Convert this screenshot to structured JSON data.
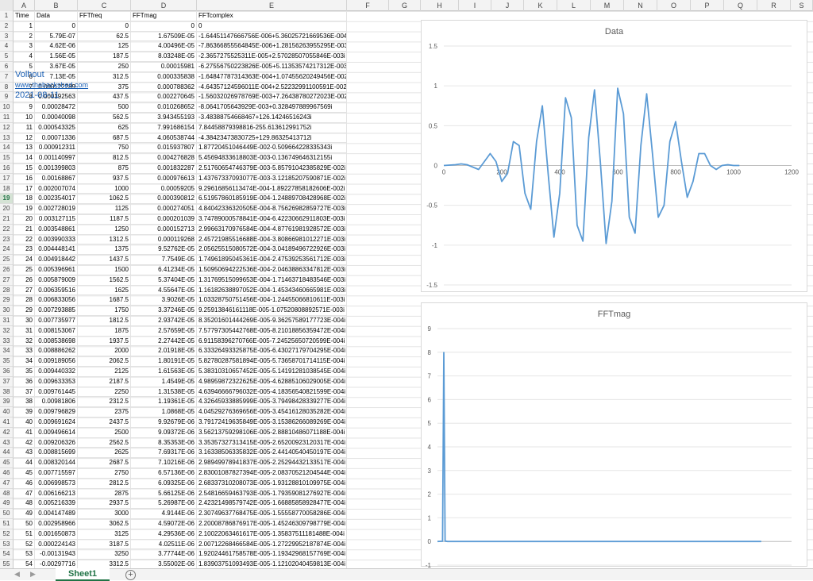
{
  "column_letters": [
    "A",
    "B",
    "C",
    "D",
    "E",
    "F",
    "G",
    "H",
    "I",
    "J",
    "K",
    "L",
    "M",
    "N",
    "O",
    "P",
    "Q",
    "R",
    "S"
  ],
  "selected_row": "19",
  "header_row": {
    "a": "Time",
    "b": "Data",
    "c": "FFTfreq",
    "d": "FFTmag",
    "e": "FFTcomplex"
  },
  "rows": [
    {
      "n": "2",
      "a": "1",
      "b": "0",
      "c": "0",
      "d": "0",
      "e": "0"
    },
    {
      "n": "3",
      "a": "2",
      "b": "5.79E-07",
      "c": "62.5",
      "d": "1.67509E-05",
      "e": "-1.64451147666756E-006+5.36025721669536E-004i"
    },
    {
      "n": "4",
      "a": "3",
      "b": "4.62E-06",
      "c": "125",
      "d": "4.00496E-05",
      "e": "-7.86366855564845E-006+1.28156263955295E-003i"
    },
    {
      "n": "5",
      "a": "4",
      "b": "1.56E-05",
      "c": "187.5",
      "d": "8.03248E-05",
      "e": "-2.3657275525311E-005+2.57028507055846E-003i"
    },
    {
      "n": "6",
      "a": "5",
      "b": "3.67E-05",
      "c": "250",
      "d": "0.00015981",
      "e": "-6.27556750223826E-005+5.11353574217312E-003i"
    },
    {
      "n": "7",
      "a": "6",
      "b": "7.13E-05",
      "c": "312.5",
      "d": "0.000335838",
      "e": "-1.64847787314363E-004+1.07455620249456E-002i"
    },
    {
      "n": "8",
      "a": "7",
      "b": "0.000122289",
      "c": "375",
      "d": "0.000788362",
      "e": "-4.64357124596011E-004+2.52232991100591E-002i"
    },
    {
      "n": "9",
      "a": "8",
      "b": "0.000192563",
      "c": "437.5",
      "d": "0.002270645",
      "e": "-1.56032026978769E-003+7.26438780272023E-002i"
    },
    {
      "n": "10",
      "a": "9",
      "b": "0.00028472",
      "c": "500",
      "d": "0.010268652",
      "e": "-8.0641705643929E-003+0.328497889967569i"
    },
    {
      "n": "11",
      "a": "10",
      "b": "0.00040098",
      "c": "562.5",
      "d": "3.943455193",
      "e": "-3.48388754668467+126.14246516243i"
    },
    {
      "n": "12",
      "a": "11",
      "b": "0.000543325",
      "c": "625",
      "d": "7.991686154",
      "e": "7.84458879398816-255.613612991752i"
    },
    {
      "n": "13",
      "a": "12",
      "b": "0.00071336",
      "c": "687.5",
      "d": "4.060538744",
      "e": "-4.38423473830725+129.86325413712i"
    },
    {
      "n": "14",
      "a": "13",
      "b": "0.000912311",
      "c": "750",
      "d": "0.015937807",
      "e": "1.87720451046449E-002-0.509664228335343i"
    },
    {
      "n": "15",
      "a": "14",
      "b": "0.001140997",
      "c": "812.5",
      "d": "0.004276828",
      "e": "5.45694833618803E-003-0.136749646312155i"
    },
    {
      "n": "16",
      "a": "15",
      "b": "0.001399803",
      "c": "875",
      "d": "0.001832287",
      "e": "2.51760654746379E-003-5.85791042385829E-002i"
    },
    {
      "n": "17",
      "a": "16",
      "b": "0.00168867",
      "c": "937.5",
      "d": "0.000976613",
      "e": "1.43767337093077E-003-3.12185207590871E-002i"
    },
    {
      "n": "18",
      "a": "17",
      "b": "0.002007074",
      "c": "1000",
      "d": "0.00059205",
      "e": "9.29616856113474E-004-1.89227858182606E-002i"
    },
    {
      "n": "19",
      "a": "18",
      "b": "0.002354017",
      "c": "1062.5",
      "d": "0.000390812",
      "e": "6.51957860185919E-004-1.24889708428968E-002i"
    },
    {
      "n": "20",
      "a": "19",
      "b": "0.002728019",
      "c": "1125",
      "d": "0.000274051",
      "e": "4.84042336320505E-004-8.75626982859727E-003i"
    },
    {
      "n": "21",
      "a": "20",
      "b": "0.003127115",
      "c": "1187.5",
      "d": "0.000201039",
      "e": "3.74789000578841E-004-6.42230662911803E-003i"
    },
    {
      "n": "22",
      "a": "21",
      "b": "0.003548861",
      "c": "1250",
      "d": "0.000152713",
      "e": "2.99663170976584E-004-4.87761981928572E-003i"
    },
    {
      "n": "23",
      "a": "22",
      "b": "0.003990333",
      "c": "1312.5",
      "d": "0.000119268",
      "e": "2.45721985516688E-004-3.80866981012271E-003i"
    },
    {
      "n": "24",
      "a": "23",
      "b": "0.004448141",
      "c": "1375",
      "d": "9.52762E-05",
      "e": "2.05625515080572E-004-3.04189496722926E-003i"
    },
    {
      "n": "25",
      "a": "24",
      "b": "0.004918442",
      "c": "1437.5",
      "d": "7.7549E-05",
      "e": "1.74961895045361E-004-2.47539253561712E-003i"
    },
    {
      "n": "26",
      "a": "25",
      "b": "0.005396961",
      "c": "1500",
      "d": "6.41234E-05",
      "e": "1.50950694222536E-004-2.04638863347812E-003i"
    },
    {
      "n": "27",
      "a": "26",
      "b": "0.005879009",
      "c": "1562.5",
      "d": "5.37404E-05",
      "e": "1.31769515099653E-004-1.71463718483546E-003i"
    },
    {
      "n": "28",
      "a": "27",
      "b": "0.006359516",
      "c": "1625",
      "d": "4.55647E-05",
      "e": "1.16182638897052E-004-1.45343460665981E-003i"
    },
    {
      "n": "29",
      "a": "28",
      "b": "0.006833056",
      "c": "1687.5",
      "d": "3.9026E-05",
      "e": "1.03328750751456E-004-1.24455066810611E-003i"
    },
    {
      "n": "30",
      "a": "29",
      "b": "0.007293885",
      "c": "1750",
      "d": "3.37246E-05",
      "e": "9.25913846161118E-005-1.07520808892571E-003i"
    },
    {
      "n": "31",
      "a": "30",
      "b": "0.007735977",
      "c": "1812.5",
      "d": "2.93742E-05",
      "e": "8.35201601444269E-005-9.36257589177723E-004i"
    },
    {
      "n": "32",
      "a": "31",
      "b": "0.008153067",
      "c": "1875",
      "d": "2.57659E-05",
      "e": "7.57797305442768E-005-8.21018856359472E-004i"
    },
    {
      "n": "33",
      "a": "32",
      "b": "0.008538698",
      "c": "1937.5",
      "d": "2.27442E-05",
      "e": "6.91158396270766E-005-7.24525650720599E-004i"
    },
    {
      "n": "34",
      "a": "33",
      "b": "0.008886262",
      "c": "2000",
      "d": "2.01918E-05",
      "e": "6.33326493325875E-005-6.43027179704295E-004i"
    },
    {
      "n": "35",
      "a": "34",
      "b": "0.009189056",
      "c": "2062.5",
      "d": "1.80191E-05",
      "e": "5.82780287581894E-005-5.73658701714115E-004i"
    },
    {
      "n": "36",
      "a": "35",
      "b": "0.009440332",
      "c": "2125",
      "d": "1.61563E-05",
      "e": "5.38310310657452E-005-5.14191281038545E-004i"
    },
    {
      "n": "37",
      "a": "36",
      "b": "0.009633353",
      "c": "2187.5",
      "d": "1.4549E-05",
      "e": "4.98959872322625E-005-4.62885106029005E-004i"
    },
    {
      "n": "38",
      "a": "37",
      "b": "0.009761445",
      "c": "2250",
      "d": "1.31538E-05",
      "e": "4.63946666796032E-005-4.18356540821599E-004i"
    },
    {
      "n": "39",
      "a": "38",
      "b": "0.00981806",
      "c": "2312.5",
      "d": "1.19361E-05",
      "e": "4.32645933885999E-005-3.79498428339277E-004i"
    },
    {
      "n": "40",
      "a": "39",
      "b": "0.009796829",
      "c": "2375",
      "d": "1.0868E-05",
      "e": "4.04529276369656E-005-3.45416128035282E-004i"
    },
    {
      "n": "41",
      "a": "40",
      "b": "0.009691624",
      "c": "2437.5",
      "d": "9.92679E-06",
      "e": "3.79172419635849E-005-3.15386266089269E-004i"
    },
    {
      "n": "42",
      "a": "41",
      "b": "0.009496614",
      "c": "2500",
      "d": "9.09372E-06",
      "e": "3.56213759298106E-005-2.88810486071188E-004i"
    },
    {
      "n": "43",
      "a": "42",
      "b": "0.009206326",
      "c": "2562.5",
      "d": "8.35353E-06",
      "e": "3.35357327313415E-005-2.65200923120317E-004i"
    },
    {
      "n": "44",
      "a": "43",
      "b": "0.008815699",
      "c": "2625",
      "d": "7.69317E-06",
      "e": "3.16338506335832E-005-2.44140540450197E-004i"
    },
    {
      "n": "45",
      "a": "44",
      "b": "0.008320144",
      "c": "2687.5",
      "d": "7.10216E-06",
      "e": "2.98949978941837E-005-2.25294432133517E-004i"
    },
    {
      "n": "46",
      "a": "45",
      "b": "0.007715597",
      "c": "2750",
      "d": "6.57136E-06",
      "e": "2.83001087827394E-005-2.08370521204544E-004i"
    },
    {
      "n": "47",
      "a": "46",
      "b": "0.006998573",
      "c": "2812.5",
      "d": "6.09325E-06",
      "e": "2.68337310208073E-005-1.93128810109975E-004i"
    },
    {
      "n": "48",
      "a": "47",
      "b": "0.006166213",
      "c": "2875",
      "d": "5.66125E-06",
      "e": "2.54816659463793E-005-1.79359081276927E-004i"
    },
    {
      "n": "49",
      "a": "48",
      "b": "0.005216339",
      "c": "2937.5",
      "d": "5.26987E-06",
      "e": "2.42321498579742E-005-1.66885858928477E-004i"
    },
    {
      "n": "50",
      "a": "49",
      "b": "0.004147489",
      "c": "3000",
      "d": "4.9144E-06",
      "e": "2.30749637768475E-005-1.55558770058286E-004i"
    },
    {
      "n": "51",
      "a": "50",
      "b": "0.002958966",
      "c": "3062.5",
      "d": "4.59072E-06",
      "e": "2.20008786876917E-005-1.45246309798779E-004i"
    },
    {
      "n": "52",
      "a": "51",
      "b": "0.001650873",
      "c": "3125",
      "d": "4.29536E-06",
      "e": "2.10022063461617E-005-1.35837511181488E-004i"
    },
    {
      "n": "53",
      "a": "52",
      "b": "0.000224143",
      "c": "3187.5",
      "d": "4.02511E-06",
      "e": "2.00712268466584E-005-1.27229952187874E-004i"
    },
    {
      "n": "54",
      "a": "53",
      "b": "-0.00131943",
      "c": "3250",
      "d": "3.77744E-06",
      "e": "1.92024461758578E-005-1.19342968157769E-004i"
    },
    {
      "n": "55",
      "a": "54",
      "b": "-0.00297716",
      "c": "3312.5",
      "d": "3.55002E-06",
      "e": "1.83903751093493E-005-1.12102040459813E-004i"
    }
  ],
  "watermark": {
    "author": "Volhout",
    "site": "www.thebackshed.com",
    "date": "2021-08-11"
  },
  "sheet_tab": "Sheet1",
  "add_sheet_symbol": "+",
  "accent_color": "#217346",
  "series_color": "#5b9bd5",
  "chart_data": [
    {
      "type": "line",
      "title": "Data",
      "xlim": [
        0,
        1200
      ],
      "ylim": [
        -1.5,
        1.5
      ],
      "xticks": [
        "0",
        "200",
        "400",
        "600",
        "800",
        "1000",
        "1200"
      ],
      "yticks": [
        "1.5",
        "1",
        "0.5",
        "0",
        "-0.5",
        "-1",
        "-1.5"
      ],
      "grid": true,
      "description_formula": "chirp-like burst, zero outside ~0-1024, peak about 1 near x=580",
      "x": [
        0,
        20,
        40,
        60,
        80,
        100,
        120,
        140,
        160,
        180,
        200,
        220,
        240,
        260,
        280,
        300,
        320,
        340,
        360,
        380,
        400,
        420,
        440,
        460,
        480,
        500,
        520,
        540,
        560,
        580,
        600,
        620,
        640,
        660,
        680,
        700,
        720,
        740,
        760,
        780,
        800,
        820,
        840,
        860,
        880,
        900,
        920,
        940,
        960,
        980,
        1000,
        1020
      ],
      "values": [
        0,
        0.005,
        0.01,
        0.02,
        0.01,
        -0.02,
        -0.05,
        0.05,
        0.15,
        0.05,
        -0.2,
        -0.1,
        0.3,
        0.25,
        -0.35,
        -0.55,
        0.3,
        0.75,
        -0.1,
        -0.9,
        -0.35,
        0.85,
        0.6,
        -0.75,
        -0.95,
        0.35,
        0.95,
        0.05,
        -0.98,
        -0.45,
        0.97,
        0.65,
        -0.65,
        -0.85,
        0.25,
        0.9,
        0.15,
        -0.65,
        -0.5,
        0.3,
        0.55,
        0.05,
        -0.4,
        -0.2,
        0.15,
        0.15,
        0.0,
        -0.05,
        0.0,
        0.01,
        0.0,
        0.0
      ]
    },
    {
      "type": "line",
      "title": "FFTmag",
      "xlim": [
        0,
        35000
      ],
      "ylim": [
        -1,
        9
      ],
      "xticks": [
        "0",
        "5000",
        "10000",
        "15000",
        "20000",
        "25000",
        "30000",
        "35000"
      ],
      "yticks": [
        "9",
        "8",
        "7",
        "6",
        "5",
        "4",
        "3",
        "2",
        "1",
        "0",
        "-1"
      ],
      "grid": true,
      "x": [
        0,
        500,
        562.5,
        625,
        687.5,
        750,
        1000,
        2000,
        5000,
        10000,
        15000,
        20000,
        25000,
        30000,
        32000
      ],
      "values": [
        0,
        0.01,
        3.94,
        7.99,
        4.06,
        0.016,
        0.0006,
        2e-05,
        0,
        0,
        0,
        0,
        0,
        0,
        0
      ]
    }
  ]
}
